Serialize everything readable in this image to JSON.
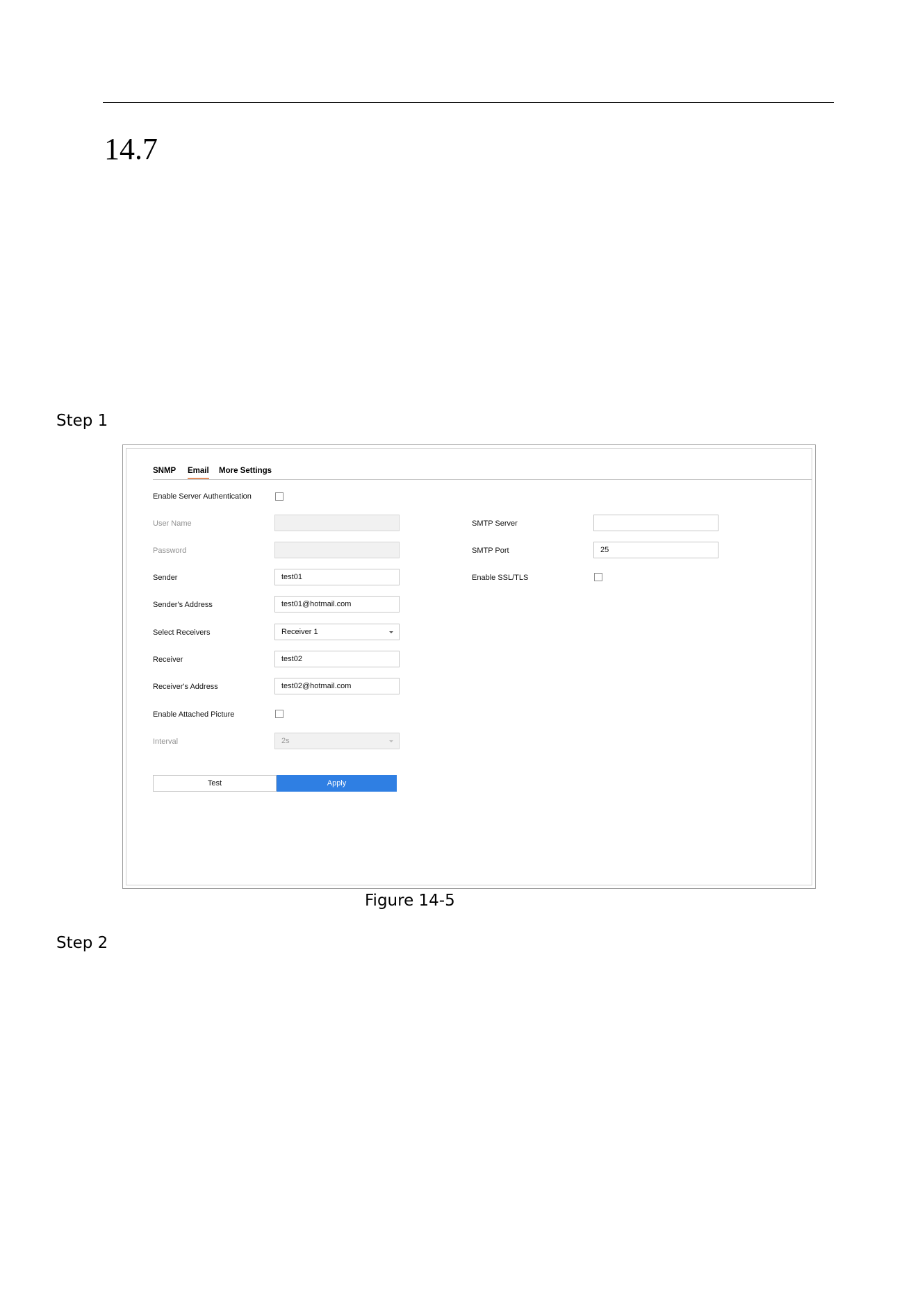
{
  "document": {
    "section_number": "14.7",
    "step1": "Step 1",
    "step2": "Step 2",
    "figure_caption": "Figure 14-5"
  },
  "ui": {
    "tabs": [
      {
        "label": "SNMP",
        "active": false
      },
      {
        "label": "Email",
        "active": true
      },
      {
        "label": "More Settings",
        "active": false
      }
    ],
    "left": {
      "enable_server_auth": {
        "label": "Enable Server Authentication",
        "checked": false
      },
      "user_name": {
        "label": "User Name",
        "value": "",
        "disabled": true
      },
      "password": {
        "label": "Password",
        "value": "",
        "disabled": true
      },
      "sender": {
        "label": "Sender",
        "value": "test01"
      },
      "sender_address": {
        "label": "Sender's Address",
        "value": "test01@hotmail.com"
      },
      "select_receivers": {
        "label": "Select Receivers",
        "value": "Receiver 1"
      },
      "receiver": {
        "label": "Receiver",
        "value": "test02"
      },
      "receiver_address": {
        "label": "Receiver's Address",
        "value": "test02@hotmail.com"
      },
      "enable_attached_picture": {
        "label": "Enable Attached Picture",
        "checked": false
      },
      "interval": {
        "label": "Interval",
        "value": "2s",
        "disabled": true
      }
    },
    "right": {
      "smtp_server": {
        "label": "SMTP Server",
        "value": ""
      },
      "smtp_port": {
        "label": "SMTP Port",
        "value": "25"
      },
      "enable_ssl": {
        "label": "Enable SSL/TLS",
        "checked": false
      }
    },
    "buttons": {
      "test": "Test",
      "apply": "Apply"
    },
    "colors": {
      "accent": "#2f7fe3",
      "tab_underline": "#e08a5a"
    }
  }
}
